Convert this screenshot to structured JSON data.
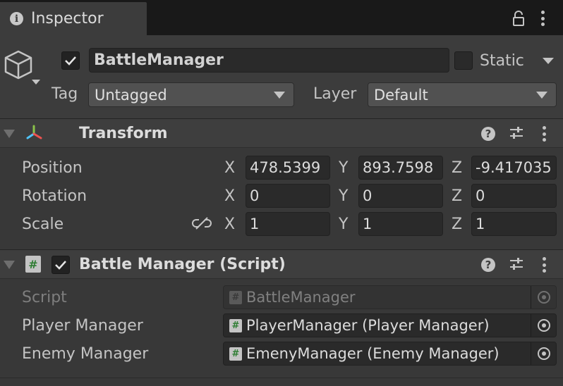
{
  "tab": {
    "title": "Inspector",
    "icon": "info-icon"
  },
  "gameobject": {
    "active": true,
    "name": "BattleManager",
    "static_label": "Static",
    "static_checked": false,
    "tag_label": "Tag",
    "tag_value": "Untagged",
    "layer_label": "Layer",
    "layer_value": "Default"
  },
  "transform": {
    "title": "Transform",
    "rows": [
      {
        "label": "Position",
        "x": "478.5399",
        "y": "893.7598",
        "z": "-9.417035"
      },
      {
        "label": "Rotation",
        "x": "0",
        "y": "0",
        "z": "0"
      },
      {
        "label": "Scale",
        "x": "1",
        "y": "1",
        "z": "1"
      }
    ],
    "axes": {
      "x": "X",
      "y": "Y",
      "z": "Z"
    }
  },
  "script_component": {
    "title": "Battle Manager (Script)",
    "enabled": true,
    "fields": [
      {
        "label": "Script",
        "value": "BattleManager",
        "disabled": true
      },
      {
        "label": "Player Manager",
        "value": "PlayerManager (Player Manager)",
        "disabled": false
      },
      {
        "label": "Enemy Manager",
        "value": "EmenyManager (Enemy Manager)",
        "disabled": false
      }
    ]
  },
  "colors": {
    "accent_check": "#e6e6e6",
    "script_icon": "#2e7d32"
  }
}
